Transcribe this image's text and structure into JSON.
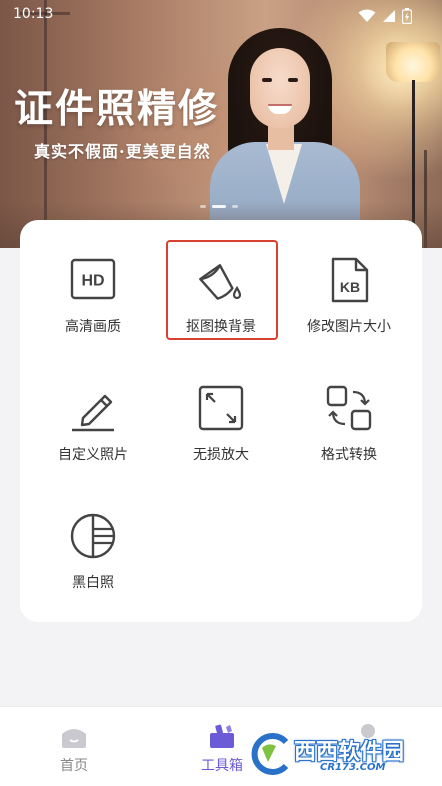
{
  "status_bar": {
    "time": "10:13",
    "icons": [
      "wifi-icon",
      "signal-icon",
      "battery-icon"
    ]
  },
  "banner": {
    "title": "证件照精修",
    "subtitle": "真实不假面·更美更自然",
    "slides_total": 3,
    "active_slide": 2
  },
  "tools": [
    {
      "id": "hd",
      "label": "高清画质",
      "icon": "hd-icon"
    },
    {
      "id": "cutout",
      "label": "抠图换背景",
      "icon": "paint-bucket-icon",
      "highlighted": true
    },
    {
      "id": "resize",
      "label": "修改图片大小",
      "icon": "kb-file-icon"
    },
    {
      "id": "custom",
      "label": "自定义照片",
      "icon": "pencil-icon"
    },
    {
      "id": "upscale",
      "label": "无损放大",
      "icon": "expand-icon"
    },
    {
      "id": "convert",
      "label": "格式转换",
      "icon": "convert-icon"
    },
    {
      "id": "bw",
      "label": "黑白照",
      "icon": "bw-circle-icon"
    }
  ],
  "bottom_nav": [
    {
      "label": "首页",
      "icon": "home-icon",
      "active": false
    },
    {
      "label": "工具箱",
      "icon": "toolbox-icon",
      "active": true
    },
    {
      "label": "",
      "icon": "profile-icon",
      "active": false
    }
  ],
  "watermark": {
    "name": "西西软件园",
    "url": "CR173.COM"
  },
  "colors": {
    "accent": "#6b5bd6",
    "highlight_border": "#d8412f",
    "icon_stroke": "#444444"
  }
}
